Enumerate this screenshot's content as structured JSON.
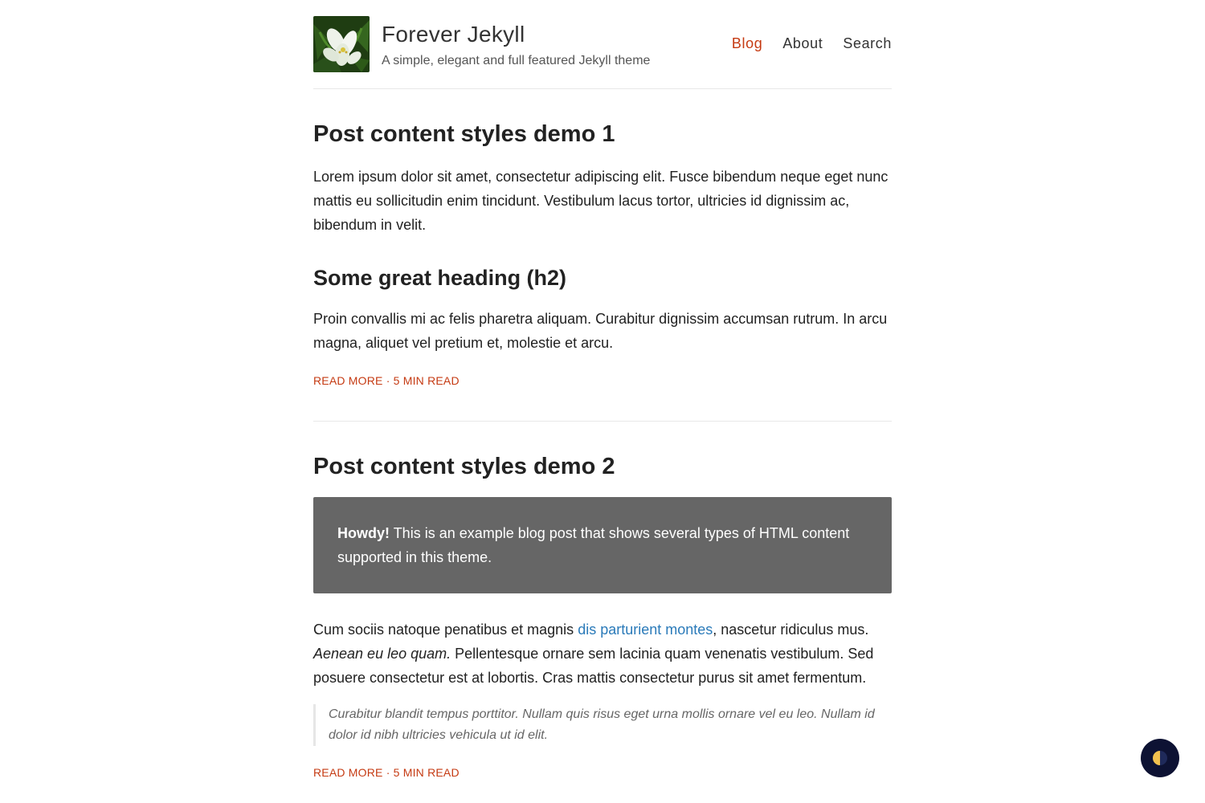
{
  "header": {
    "site_title": "Forever Jekyll",
    "tagline": "A simple, elegant and full featured Jekyll theme",
    "nav": [
      {
        "label": "Blog",
        "active": true
      },
      {
        "label": "About",
        "active": false
      },
      {
        "label": "Search",
        "active": false
      }
    ]
  },
  "posts": [
    {
      "title": "Post content styles demo 1",
      "intro": "Lorem ipsum dolor sit amet, consectetur adipiscing elit. Fusce bibendum neque eget nunc mattis eu sollicitudin enim tincidunt. Vestibulum lacus tortor, ultricies id dignissim ac, bibendum in velit.",
      "heading": "Some great heading (h2)",
      "body": "Proin convallis mi ac felis pharetra aliquam. Curabitur dignissim accumsan rutrum. In arcu magna, aliquet vel pretium et, molestie et arcu.",
      "read_more": "Read more",
      "separator": "·",
      "read_time": "5 min read"
    },
    {
      "title": "Post content styles demo 2",
      "notice_strong": "Howdy!",
      "notice_text": "This is an example blog post that shows several types of HTML content supported in this theme.",
      "para_start": "Cum sociis natoque penatibus et magnis ",
      "para_link": "dis parturient montes",
      "para_after_link": ", nascetur ridiculus mus.",
      "para_em": "Aenean eu leo quam.",
      "para_end": " Pellentesque ornare sem lacinia quam venenatis vestibulum. Sed posuere consectetur est at lobortis. Cras mattis consectetur purus sit amet fermentum.",
      "blockquote": "Curabitur blandit tempus porttitor. Nullam quis risus eget urna mollis ornare vel eu leo. Nullam id dolor id nibh ultricies vehicula ut id elit.",
      "read_more": "Read more",
      "separator": "·",
      "read_time": "5 min read"
    }
  ],
  "colors": {
    "accent": "#c53a12",
    "link": "#2a7ab9",
    "notice_bg": "#666666",
    "toggle_bg": "#0d1233"
  },
  "icons": {
    "logo": "lily-flower-photo",
    "theme_toggle": "half-moon-icon"
  }
}
